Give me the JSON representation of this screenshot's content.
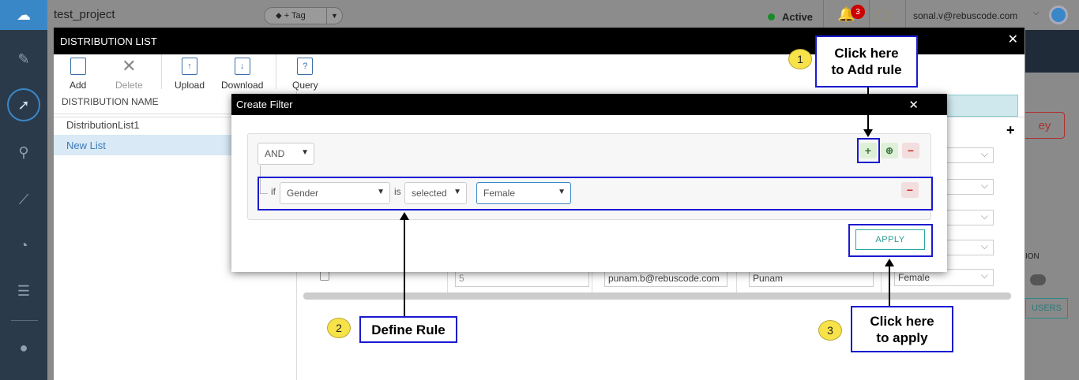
{
  "topbar": {
    "project": "test_project",
    "tag_label": "+ Tag",
    "status": "Active",
    "notification_count": "3",
    "user_email": "sonal.v@rebuscode.com"
  },
  "right_panel": {
    "key_button_fragment": "ey",
    "ion_fragment": "ION",
    "users_fragment": "USERS"
  },
  "distribution_list": {
    "title": "DISTRIBUTION LIST",
    "toolbar": {
      "add": "Add",
      "delete": "Delete",
      "upload": "Upload",
      "download": "Download",
      "query": "Query"
    },
    "list_header": "DISTRIBUTION NAME",
    "items": [
      "DistributionList1",
      "New List"
    ],
    "visible_row": {
      "id": "5",
      "email": "punam.b@rebuscode.com",
      "name": "Punam",
      "gender": "Female"
    }
  },
  "create_filter": {
    "title": "Create Filter",
    "condition": "AND",
    "rule": {
      "if_label": "if",
      "field": "Gender",
      "is_label": "is",
      "operator": "selected",
      "value": "Female"
    },
    "apply_label": "APPLY"
  },
  "annotations": {
    "step1_num": "1",
    "step1_line1": "Click here",
    "step1_line2": "to Add rule",
    "step2_num": "2",
    "step2_text": "Define Rule",
    "step3_num": "3",
    "step3_line1": "Click here",
    "step3_line2": "to apply"
  },
  "colors": {
    "annotation_blue": "#1a1ad0",
    "bubble_yellow": "#f7e24a",
    "header_black": "#000000",
    "apply_teal": "#2aa8a0"
  }
}
